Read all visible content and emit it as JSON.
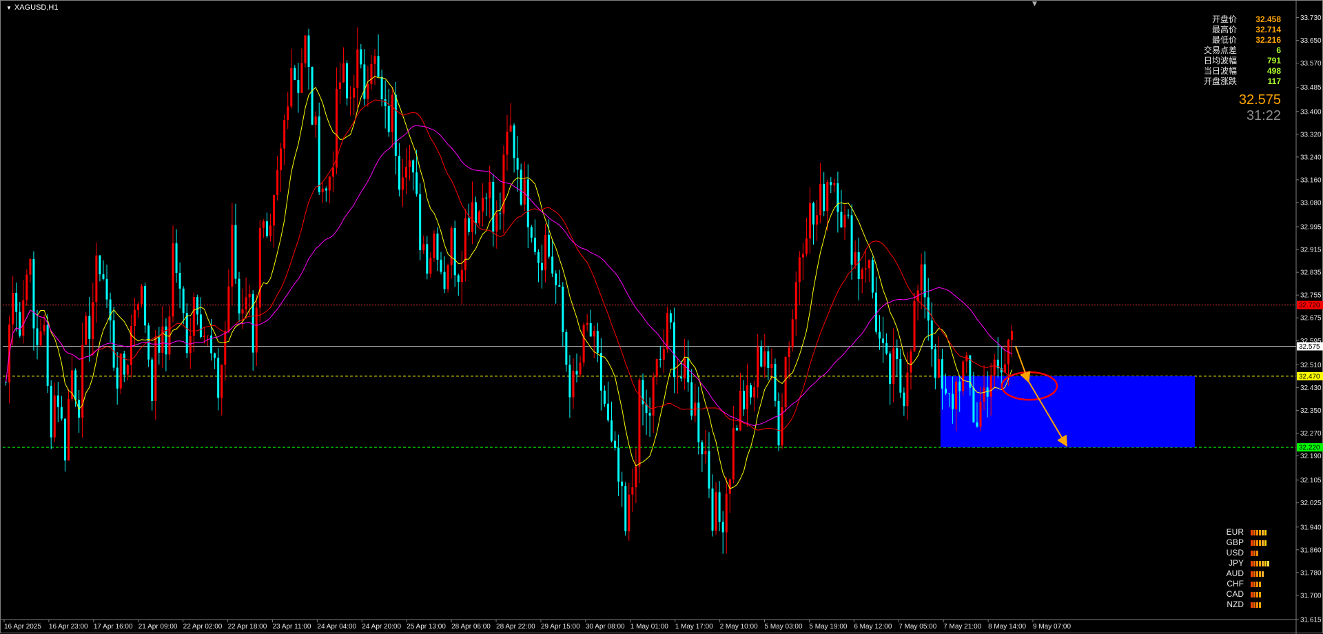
{
  "window": {
    "symbol_title": "XAGUSD,H1"
  },
  "info_panel": [
    {
      "label": "开盘价",
      "value": "32.458",
      "color": "#ffa500"
    },
    {
      "label": "最高价",
      "value": "32.714",
      "color": "#ffa500"
    },
    {
      "label": "最低价",
      "value": "32.216",
      "color": "#ffa500"
    },
    {
      "label": "交易点差",
      "value": "6",
      "color": "#adff2f"
    },
    {
      "label": "日均波幅",
      "value": "791",
      "color": "#adff2f"
    },
    {
      "label": "当日波幅",
      "value": "498",
      "color": "#adff2f"
    },
    {
      "label": "开盘涨跌",
      "value": "117",
      "color": "#adff2f"
    }
  ],
  "current_price": "32.575",
  "bar_countdown": "31:22",
  "currency_strength": [
    {
      "ccy": "EUR",
      "bars": 6
    },
    {
      "ccy": "GBP",
      "bars": 6
    },
    {
      "ccy": "USD",
      "bars": 3
    },
    {
      "ccy": "JPY",
      "bars": 7
    },
    {
      "ccy": "AUD",
      "bars": 5
    },
    {
      "ccy": "CHF",
      "bars": 4
    },
    {
      "ccy": "CAD",
      "bars": 4
    },
    {
      "ccy": "NZD",
      "bars": 4
    }
  ],
  "colors": {
    "bull": "#ff0000",
    "bear": "#00ffff",
    "ma_fast": "#ffff00",
    "ma_mid": "#ff0000",
    "ma_slow": "#ff00ff",
    "zone": "#0000ff",
    "arrow": "#ffa500",
    "ellipse": "#ff0000"
  },
  "chart_data": {
    "type": "candlestick",
    "symbol": "XAGUSD",
    "timeframe": "H1",
    "ylim": [
      31.615,
      33.77
    ],
    "y_ticks": [
      "33.730",
      "33.650",
      "33.570",
      "33.485",
      "33.400",
      "33.320",
      "33.240",
      "33.160",
      "33.080",
      "32.995",
      "32.915",
      "32.835",
      "32.755",
      "32.675",
      "32.595",
      "32.510",
      "32.430",
      "32.350",
      "32.270",
      "32.190",
      "32.105",
      "32.025",
      "31.940",
      "31.860",
      "31.780",
      "31.700",
      "31.615"
    ],
    "x_ticks": [
      "16 Apr 2025",
      "16 Apr 23:00",
      "17 Apr 16:00",
      "21 Apr 09:00",
      "22 Apr 02:00",
      "22 Apr 18:00",
      "23 Apr 11:00",
      "24 Apr 04:00",
      "24 Apr 20:00",
      "25 Apr 13:00",
      "28 Apr 06:00",
      "28 Apr 22:00",
      "29 Apr 15:00",
      "30 Apr 08:00",
      "1 May 01:00",
      "1 May 17:00",
      "2 May 10:00",
      "5 May 03:00",
      "5 May 19:00",
      "6 May 12:00",
      "7 May 05:00",
      "7 May 21:00",
      "8 May 14:00",
      "9 May 07:00"
    ],
    "price_path": [
      32.45,
      32.85,
      32.6,
      32.95,
      32.55,
      32.7,
      32.3,
      32.45,
      32.2,
      32.5,
      32.4,
      32.6,
      32.75,
      32.9,
      32.7,
      32.5,
      32.45,
      32.6,
      32.8,
      32.7,
      32.45,
      32.6,
      32.55,
      32.95,
      32.7,
      32.6,
      32.8,
      32.65,
      32.55,
      32.4,
      32.6,
      32.95,
      32.7,
      32.8,
      32.6,
      33.0,
      32.85,
      33.1,
      33.3,
      33.6,
      33.5,
      33.65,
      33.4,
      33.2,
      33.1,
      33.3,
      33.55,
      33.4,
      33.6,
      33.45,
      33.65,
      33.5,
      33.35,
      33.4,
      33.2,
      33.3,
      33.1,
      32.95,
      32.9,
      33.0,
      32.8,
      32.95,
      32.85,
      33.0,
      33.1,
      33.05,
      33.2,
      32.95,
      33.1,
      33.35,
      33.25,
      33.1,
      33.05,
      32.9,
      32.95,
      32.85,
      32.7,
      32.5,
      32.4,
      32.55,
      32.65,
      32.5,
      32.4,
      32.2,
      32.1,
      31.9,
      32.1,
      32.4,
      32.3,
      32.45,
      32.55,
      32.65,
      32.5,
      32.45,
      32.4,
      32.3,
      32.2,
      32.0,
      31.95,
      32.1,
      32.3,
      32.4,
      32.35,
      32.5,
      32.6,
      32.45,
      32.3,
      32.55,
      32.7,
      32.95,
      33.05,
      33.0,
      33.1,
      33.2,
      33.15,
      33.0,
      32.95,
      32.85,
      32.9,
      32.75,
      32.55,
      32.45,
      32.5,
      32.4,
      32.6,
      32.75,
      32.8,
      32.6,
      32.45,
      32.35,
      32.4,
      32.5,
      32.45,
      32.3,
      32.4,
      32.5,
      32.45,
      32.5,
      32.65
    ],
    "horizontal_levels": [
      {
        "price": 32.72,
        "label": "32.720",
        "style": "dotted",
        "color": "#ff3b3b",
        "label_bg": "#ff0000"
      },
      {
        "price": 32.575,
        "label": "32.575",
        "style": "solid",
        "color": "#b0b0b0",
        "label_bg": "#ffffff"
      },
      {
        "price": 32.47,
        "label": "32.470",
        "style": "dashed",
        "color": "#ffff00",
        "label_bg": "#ffff00"
      },
      {
        "price": 32.22,
        "label": "32.220",
        "style": "dashed",
        "color": "#00ff00",
        "label_bg": "#00ff00"
      }
    ],
    "target_zone": {
      "price_top": 32.47,
      "price_bottom": 32.22,
      "from_label": "9 May 07:00"
    },
    "projection": [
      32.575,
      32.455,
      32.23
    ]
  }
}
